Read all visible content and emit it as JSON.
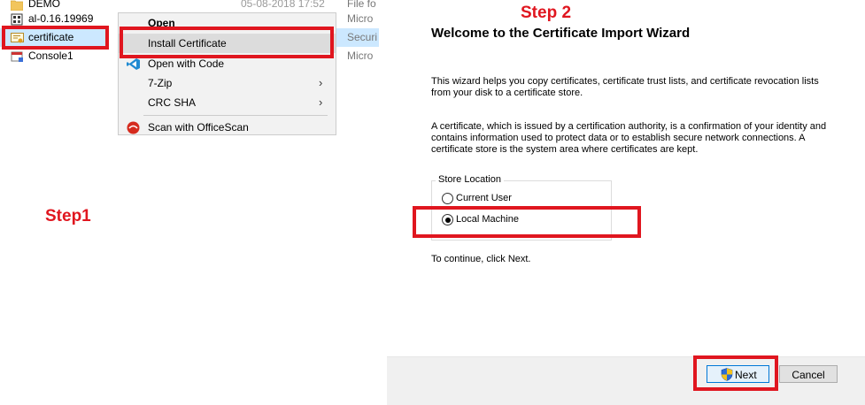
{
  "explorer": {
    "files": [
      {
        "name": "DEMO",
        "icon": "folder-icon",
        "date": "05-08-2018 17:52",
        "type": "File fo"
      },
      {
        "name": "al-0.16.19969",
        "icon": "executable-icon",
        "type": "Micro"
      },
      {
        "name": "certificate",
        "icon": "certificate-icon",
        "type": "Securi"
      },
      {
        "name": "Console1",
        "icon": "console-icon",
        "type": "Micro"
      }
    ]
  },
  "context_menu": {
    "items": [
      {
        "label": "Open"
      },
      {
        "label": "Install Certificate"
      },
      {
        "label": "Open with Code"
      },
      {
        "label": "7-Zip",
        "submenu_arrow": "›"
      },
      {
        "label": "CRC SHA",
        "submenu_arrow": "›"
      },
      {
        "label": "Scan with OfficeScan"
      }
    ]
  },
  "annotations": {
    "step1": "Step1",
    "step2": "Step 2",
    "color": "#e0161f"
  },
  "wizard": {
    "title": "Welcome to the Certificate Import Wizard",
    "intro": "This wizard helps you copy certificates, certificate trust lists, and certificate revocation lists from your disk to a certificate store.",
    "description": "A certificate, which is issued by a certification authority, is a confirmation of your identity and contains information used to protect data or to establish secure network connections. A certificate store is the system area where certificates are kept.",
    "store_location": {
      "label": "Store Location",
      "options": [
        "Current User",
        "Local Machine"
      ],
      "selected": "Local Machine"
    },
    "continue_text": "To continue, click Next.",
    "next_label": "Next",
    "cancel_label": "Cancel"
  }
}
